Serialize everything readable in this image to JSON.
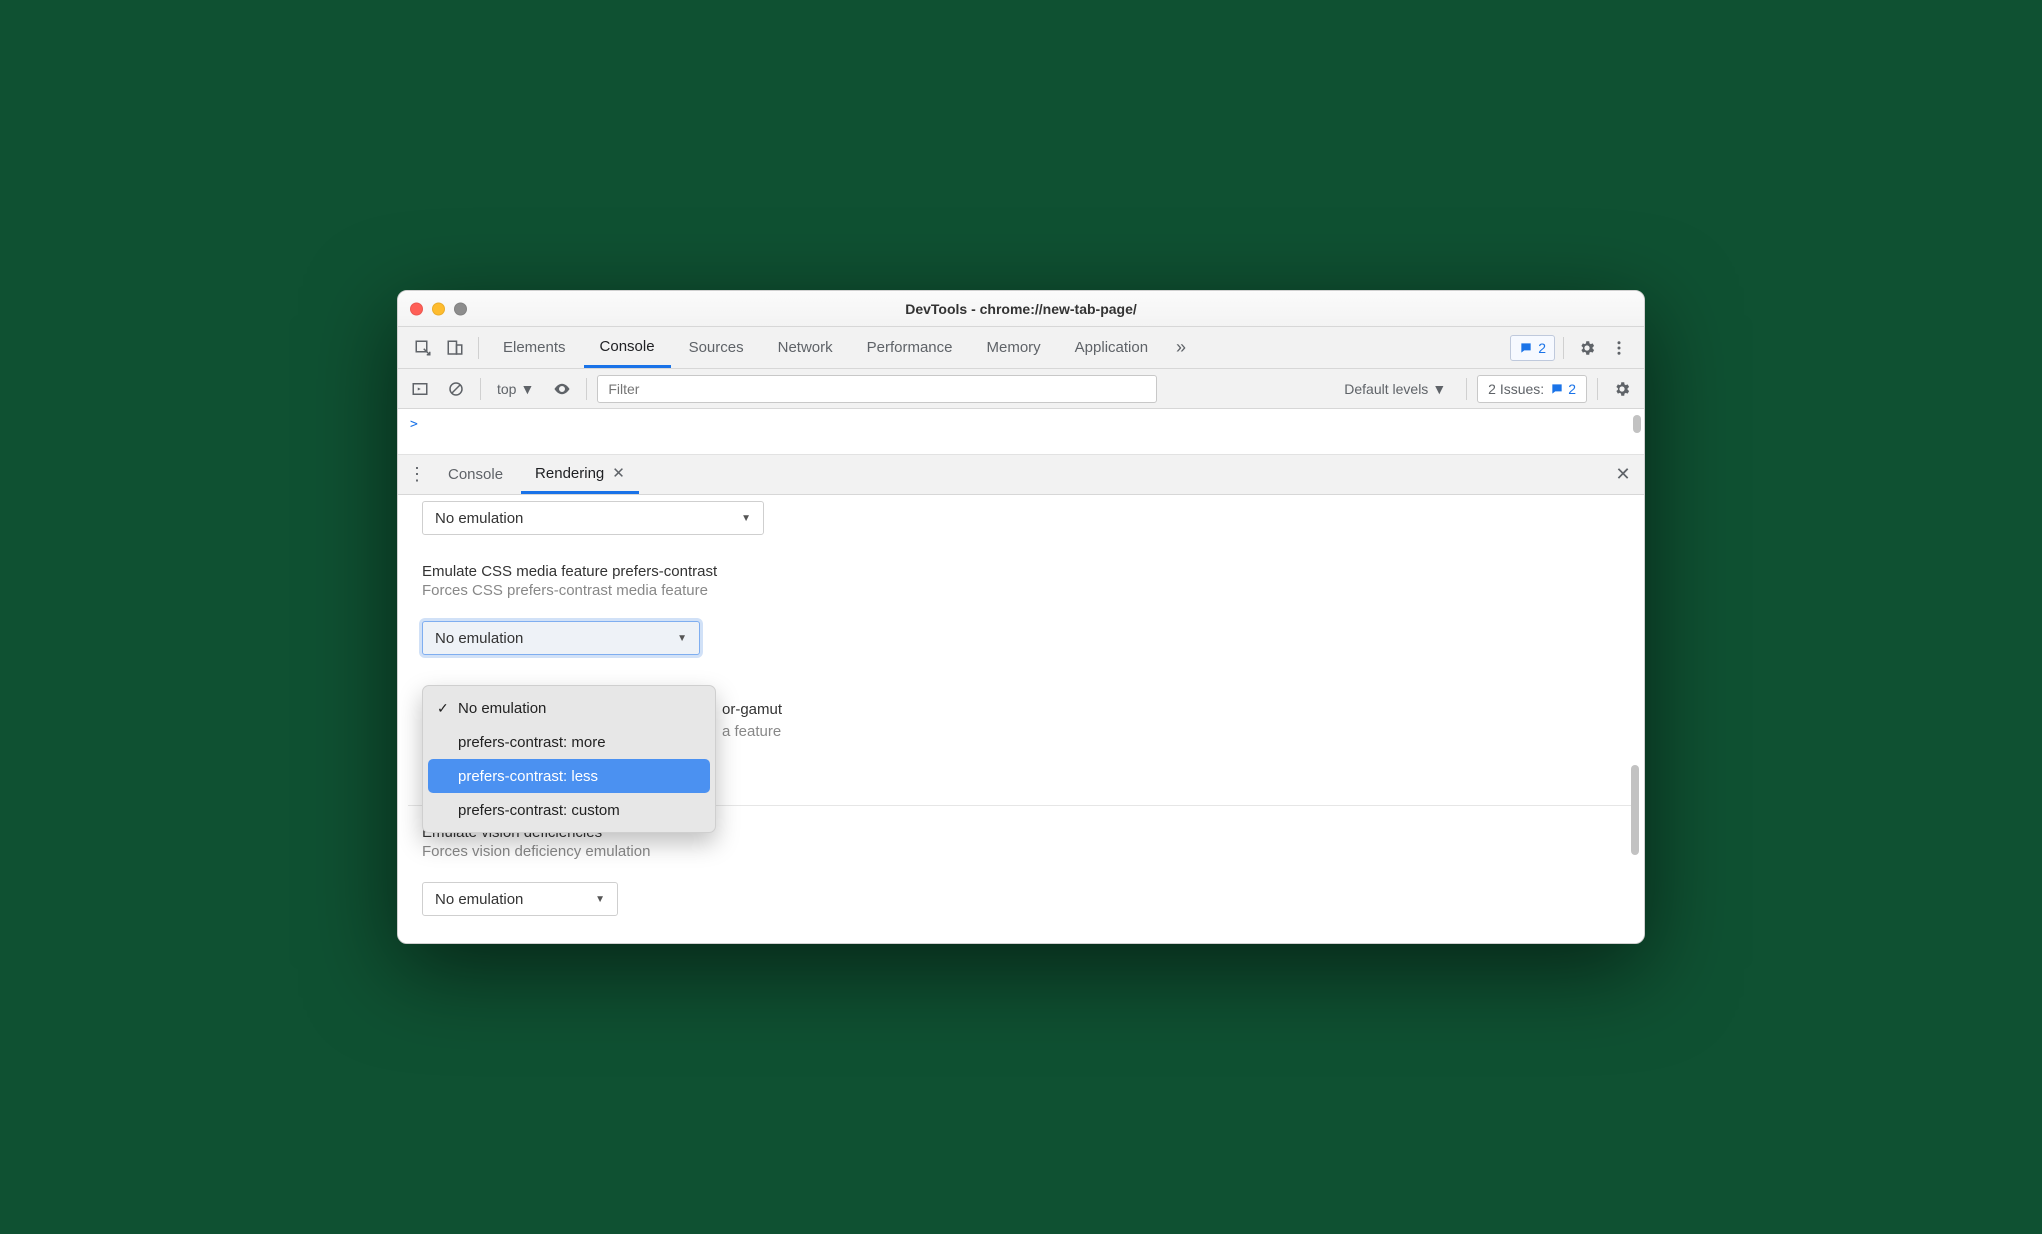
{
  "window": {
    "title": "DevTools - chrome://new-tab-page/"
  },
  "tabs": {
    "items": [
      "Elements",
      "Console",
      "Sources",
      "Network",
      "Performance",
      "Memory",
      "Application"
    ],
    "active": "Console",
    "overflow_glyph": "»",
    "feedback_count": "2"
  },
  "console_bar": {
    "context": "top",
    "filter_placeholder": "Filter",
    "levels_label": "Default levels",
    "issues_label": "2 Issues:",
    "issues_count": "2"
  },
  "console_body": {
    "prompt": ">"
  },
  "drawer": {
    "tabs": [
      "Console",
      "Rendering"
    ],
    "active": "Rendering"
  },
  "rendering": {
    "top_select_value": "No emulation",
    "contrast": {
      "title": "Emulate CSS media feature prefers-contrast",
      "subtitle": "Forces CSS prefers-contrast media feature",
      "select_value": "No emulation",
      "options": [
        "No emulation",
        "prefers-contrast: more",
        "prefers-contrast: less",
        "prefers-contrast: custom"
      ],
      "checked_index": 0,
      "highlight_index": 2
    },
    "behind": {
      "title_fragment": "or-gamut",
      "subtitle_fragment": "a feature"
    },
    "vision": {
      "title": "Emulate vision deficiencies",
      "subtitle": "Forces vision deficiency emulation",
      "select_value": "No emulation"
    }
  }
}
